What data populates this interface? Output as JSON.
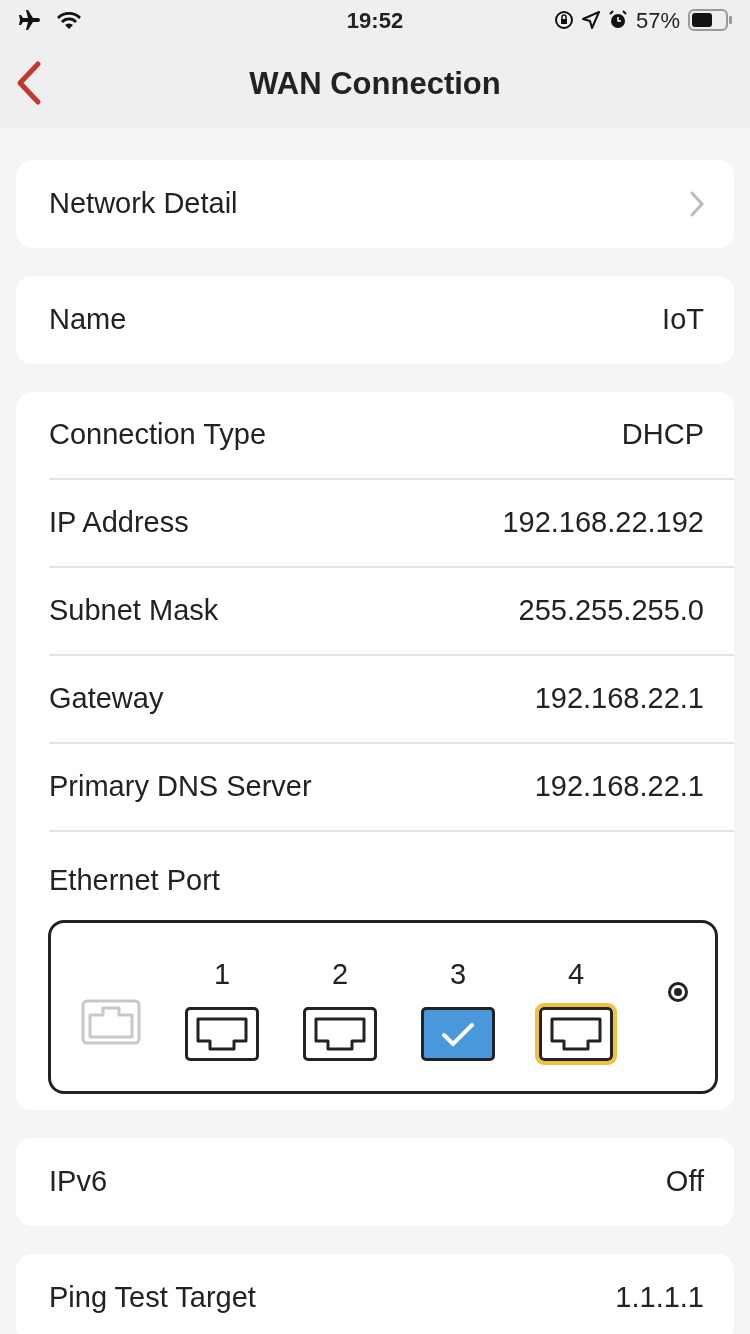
{
  "status_bar": {
    "time": "19:52",
    "battery": "57%"
  },
  "nav": {
    "title": "WAN Connection"
  },
  "network_detail": {
    "label": "Network Detail"
  },
  "name_row": {
    "label": "Name",
    "value": "IoT"
  },
  "details": [
    {
      "label": "Connection Type",
      "value": "DHCP"
    },
    {
      "label": "IP Address",
      "value": "192.168.22.192"
    },
    {
      "label": "Subnet Mask",
      "value": "255.255.255.0"
    },
    {
      "label": "Gateway",
      "value": "192.168.22.1"
    },
    {
      "label": "Primary DNS Server",
      "value": "192.168.22.1"
    }
  ],
  "ethernet": {
    "label": "Ethernet Port",
    "ports": [
      {
        "number": "1",
        "selected": false,
        "highlighted": false
      },
      {
        "number": "2",
        "selected": false,
        "highlighted": false
      },
      {
        "number": "3",
        "selected": true,
        "highlighted": false
      },
      {
        "number": "4",
        "selected": false,
        "highlighted": true
      }
    ]
  },
  "ipv6": {
    "label": "IPv6",
    "value": "Off"
  },
  "ping": {
    "label": "Ping Test Target",
    "value": "1.1.1.1"
  }
}
